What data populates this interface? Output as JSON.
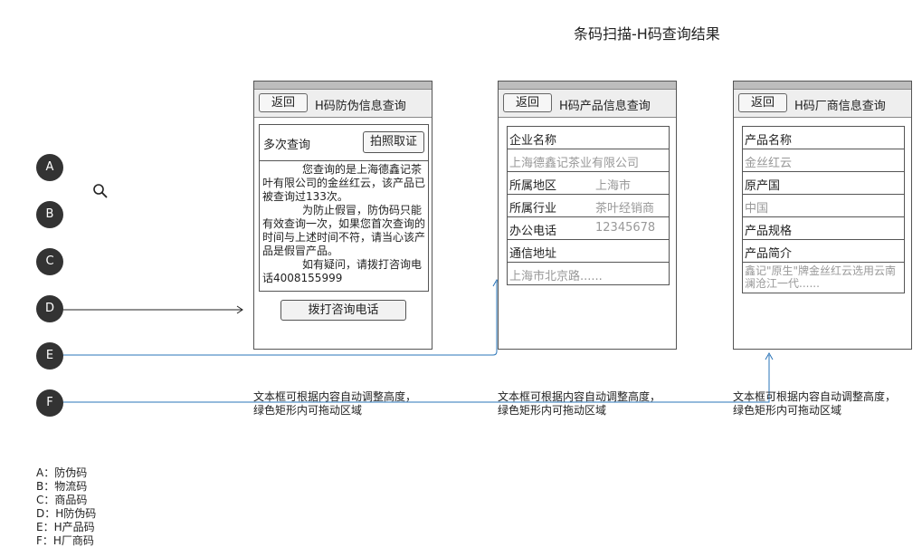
{
  "title": "条码扫描-H码查询结果",
  "circles": [
    "A",
    "B",
    "C",
    "D",
    "E",
    "F"
  ],
  "phone1": {
    "back": "返回",
    "header": "H码防伪信息查询",
    "multi_query": "多次查询",
    "photo_button": "拍照取证",
    "para1": "您查询的是上海德鑫记茶叶有限公司的金丝红云，该产品已被查询过133次。",
    "para2": "为防止假冒，防伪码只能有效查询一次，如果您首次查询的时间与上述时间不符，请当心该产品是假冒产品。",
    "para3": "如有疑问，请拨打咨询电话4008155999",
    "call_button": "拨打咨询电话"
  },
  "phone2": {
    "back": "返回",
    "header": "H码产品信息查询",
    "rows": [
      {
        "k": "企业名称",
        "v": ""
      },
      {
        "k": "上海德鑫记茶业有限公司",
        "v": ""
      },
      {
        "k": "所属地区",
        "v": "上海市"
      },
      {
        "k": "所属行业",
        "v": "茶叶经销商"
      },
      {
        "k": "办公电话",
        "v": "12345678"
      },
      {
        "k": "通信地址",
        "v": ""
      },
      {
        "k": "上海市北京路......",
        "v": ""
      }
    ]
  },
  "phone3": {
    "back": "返回",
    "header": "H码厂商信息查询",
    "rows": [
      {
        "k": "产品名称"
      },
      {
        "k": "金丝红云"
      },
      {
        "k": "原产国"
      },
      {
        "k": "中国"
      },
      {
        "k": "产品规格"
      },
      {
        "k": "产品简介"
      },
      {
        "k": "鑫记\"原生\"牌金丝红云选用云南澜沧江一代......"
      }
    ]
  },
  "note_line1": "文本框可根据内容自动调整高度，",
  "note_line2": "绿色矩形内可拖动区域",
  "legend": [
    "A：防伪码",
    "B：物流码",
    "C：商品码",
    "D：H防伪码",
    "E：H产品码",
    "F：H厂商码"
  ]
}
